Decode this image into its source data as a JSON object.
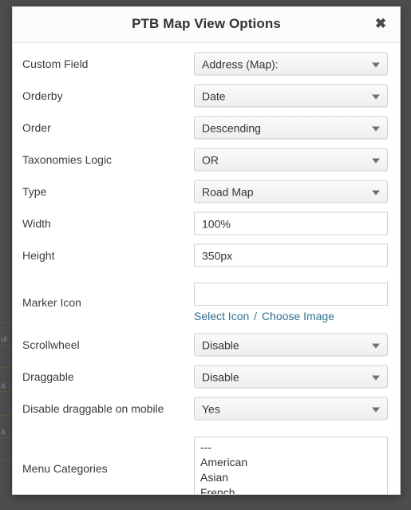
{
  "modal": {
    "title": "PTB Map View Options",
    "close_icon": "close-icon",
    "close_label": "✖"
  },
  "fields": [
    {
      "label": "Custom Field",
      "type": "select",
      "name": "custom-field",
      "value": "Address (Map):",
      "options": [
        "Address (Map):"
      ]
    },
    {
      "label": "Orderby",
      "type": "select",
      "name": "orderby",
      "value": "Date",
      "options": [
        "Date"
      ]
    },
    {
      "label": "Order",
      "type": "select",
      "name": "order",
      "value": "Descending",
      "options": [
        "Descending"
      ]
    },
    {
      "label": "Taxonomies Logic",
      "type": "select",
      "name": "taxonomies-logic",
      "value": "OR",
      "options": [
        "OR"
      ]
    },
    {
      "label": "Type",
      "type": "select",
      "name": "type",
      "value": "Road Map",
      "options": [
        "Road Map"
      ]
    },
    {
      "label": "Width",
      "type": "text",
      "name": "width",
      "value": "100%",
      "placeholder": ""
    },
    {
      "label": "Height",
      "type": "text",
      "name": "height",
      "value": "350px",
      "placeholder": ""
    },
    {
      "label": "Marker Icon",
      "type": "text-with-links",
      "name": "marker-icon",
      "value": "",
      "placeholder": "",
      "links": [
        {
          "label": "Select Icon",
          "name": "select-icon-link"
        },
        {
          "label": "Choose Image",
          "name": "choose-image-link"
        }
      ],
      "link_separator": "/"
    },
    {
      "label": "Scrollwheel",
      "type": "select",
      "name": "scrollwheel",
      "value": "Disable",
      "options": [
        "Disable"
      ]
    },
    {
      "label": "Draggable",
      "type": "select",
      "name": "draggable",
      "value": "Disable",
      "options": [
        "Disable"
      ]
    },
    {
      "label": "Disable draggable on mobile",
      "type": "select",
      "name": "disable-draggable-on-mobile",
      "value": "Yes",
      "options": [
        "Yes"
      ]
    },
    {
      "label": "Menu Categories",
      "type": "listbox",
      "name": "menu-categories",
      "options": [
        "---",
        "American",
        "Asian",
        "French"
      ]
    }
  ],
  "colors": {
    "overlay": "#4a4a4a",
    "modal_bg": "#ffffff",
    "header_bg": "#fcfcfc",
    "title_text": "#333333",
    "label_text": "#3c3c3c",
    "link": "#31708f",
    "select_bg": "#f6f6f6",
    "input_border": "#d2d2d2"
  }
}
